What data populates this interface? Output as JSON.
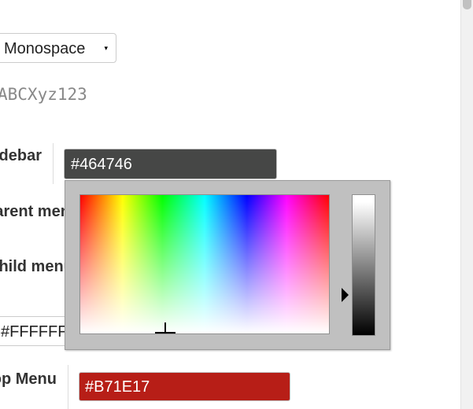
{
  "font_select": {
    "value": "Monospace",
    "arrow": "▾"
  },
  "font_preview": "ABCXyz123",
  "labels": {
    "sidebar": "Sidebar",
    "parent_menu": "Parent menu",
    "child_menu": "Child menu",
    "top_menu": "Top Menu"
  },
  "sidebar_input": {
    "value": "#464746",
    "color": "#464746"
  },
  "partial_input": {
    "value": "#FFFFFF"
  },
  "topmenu_input": {
    "value": "#B71E17",
    "color": "#B71E17"
  },
  "picker": {
    "icons": [
      "crosshair-icon",
      "slider-arrow-icon"
    ]
  }
}
